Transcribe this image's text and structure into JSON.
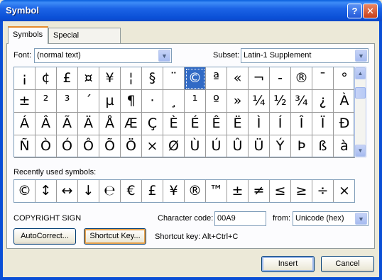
{
  "window": {
    "title": "Symbol",
    "help_glyph": "?",
    "close_glyph": "✕"
  },
  "tabs": [
    {
      "label": "Symbols",
      "active": true
    },
    {
      "label": "Special Characters",
      "active": false
    }
  ],
  "font": {
    "label": "Font:",
    "value": "(normal text)"
  },
  "subset": {
    "label": "Subset:",
    "value": "Latin-1 Supplement"
  },
  "symbol_grid": {
    "selected": "©",
    "rows": [
      [
        "¡",
        "¢",
        "£",
        "¤",
        "¥",
        "¦",
        "§",
        "¨",
        "©",
        "ª",
        "«",
        "¬",
        "-",
        "®",
        "¯",
        "°"
      ],
      [
        "±",
        "²",
        "³",
        "´",
        "µ",
        "¶",
        "·",
        "¸",
        "¹",
        "º",
        "»",
        "¼",
        "½",
        "¾",
        "¿",
        "À"
      ],
      [
        "Á",
        "Â",
        "Ã",
        "Ä",
        "Å",
        "Æ",
        "Ç",
        "È",
        "É",
        "Ê",
        "Ë",
        "Ì",
        "Í",
        "Î",
        "Ï",
        "Ð"
      ],
      [
        "Ñ",
        "Ò",
        "Ó",
        "Ô",
        "Õ",
        "Ö",
        "×",
        "Ø",
        "Ù",
        "Ú",
        "Û",
        "Ü",
        "Ý",
        "Þ",
        "ß",
        "à"
      ]
    ]
  },
  "recent": {
    "label": "Recently used symbols:",
    "symbols": [
      "©",
      "↕",
      "↔",
      "↓",
      "℮",
      "€",
      "£",
      "¥",
      "®",
      "™",
      "±",
      "≠",
      "≤",
      "≥",
      "÷",
      "×"
    ]
  },
  "character_name": "COPYRIGHT SIGN",
  "character_code": {
    "label": "Character code:",
    "value": "00A9"
  },
  "from": {
    "label": "from:",
    "value": "Unicode (hex)"
  },
  "buttons": {
    "autocorrect": "AutoCorrect...",
    "shortcut_key": "Shortcut Key...",
    "insert": "Insert",
    "cancel": "Cancel"
  },
  "shortcut_text": "Shortcut key: Alt+Ctrl+C"
}
